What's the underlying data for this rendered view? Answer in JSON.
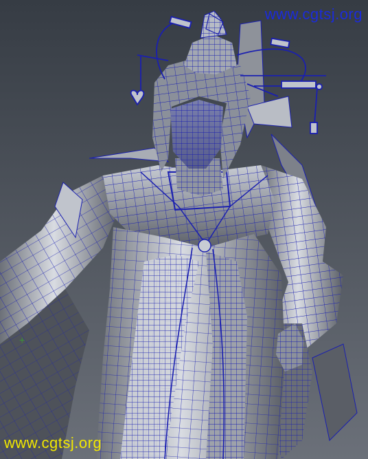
{
  "watermark_top": {
    "text": "www.cgtsj.org",
    "color": "#1b2bdc"
  },
  "watermark_bottom": {
    "text": "www.cgtsj.org",
    "color": "#f2e800"
  },
  "viewport": {
    "background_top": "#363c44",
    "background_bottom": "#6b7079",
    "wireframe_color": "#1a1fb0",
    "surface_light": "#d8dce2",
    "surface_dark": "#50545c",
    "origin_marker": {
      "symbol": "+",
      "color": "#3c8c3c"
    }
  }
}
